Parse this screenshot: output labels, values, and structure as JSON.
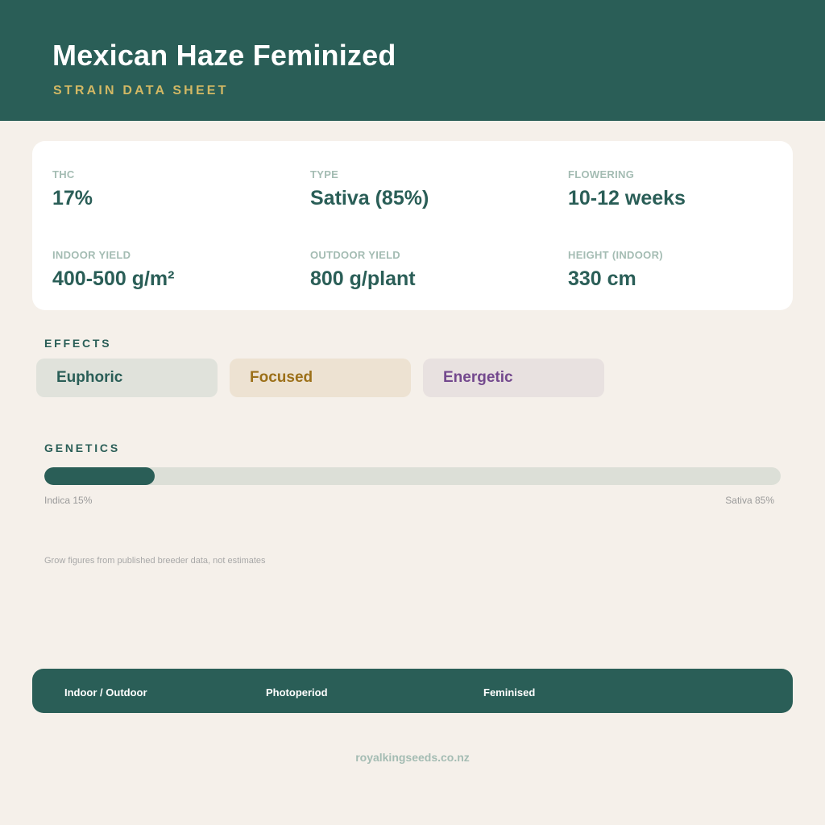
{
  "header": {
    "title": "Mexican Haze Feminized",
    "subtitle": "STRAIN DATA SHEET"
  },
  "stats": [
    {
      "label": "THC",
      "value": "17%"
    },
    {
      "label": "TYPE",
      "value": "Sativa (85%)"
    },
    {
      "label": "FLOWERING",
      "value": "10-12 weeks"
    },
    {
      "label": "INDOOR YIELD",
      "value": "400-500 g/m²"
    },
    {
      "label": "OUTDOOR YIELD",
      "value": "800 g/plant"
    },
    {
      "label": "HEIGHT (INDOOR)",
      "value": "330 cm"
    }
  ],
  "effects": {
    "heading": "EFFECTS",
    "items": [
      {
        "label": "Euphoric",
        "text_color": "#2a5e57",
        "bg_color": "#e0e2db"
      },
      {
        "label": "Focused",
        "text_color": "#9c7019",
        "bg_color": "#ede2d2"
      },
      {
        "label": "Energetic",
        "text_color": "#74498e",
        "bg_color": "#e8e1e0"
      }
    ]
  },
  "genetics": {
    "heading": "GENETICS",
    "indica_percent": 15,
    "sativa_percent": 85,
    "indica_label": "Indica 15%",
    "sativa_label": "Sativa 85%"
  },
  "note": "Grow figures from published breeder data, not estimates",
  "footer": {
    "items": [
      "Indoor / Outdoor",
      "Photoperiod",
      "Feminised"
    ],
    "site": "royalkingseeds.co.nz"
  },
  "colors": {
    "brand": "#2a5e57",
    "accent": "#d2b864",
    "background": "#f5f0ea"
  }
}
